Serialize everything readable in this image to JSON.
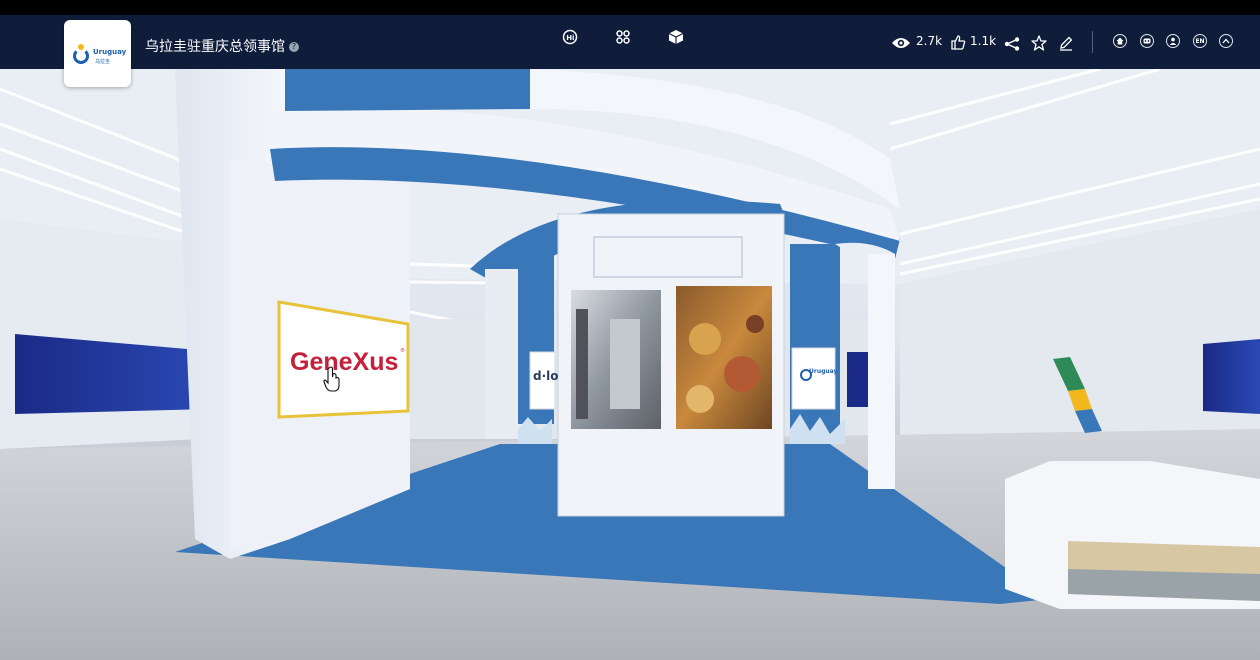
{
  "header": {
    "title": "乌拉圭驻重庆总领事馆",
    "logo": {
      "name": "Uruguay",
      "sub": "乌拉圭"
    },
    "center_icons": [
      "hi-chat-icon",
      "command-icon",
      "cube-icon"
    ],
    "stats": {
      "views": "2.7k",
      "likes": "1.1k"
    },
    "right_icons": [
      "share-icon",
      "star-icon",
      "edit-icon",
      "home-icon",
      "vr-icon",
      "user-icon",
      "language-icon",
      "collapse-icon"
    ],
    "language_label": "EN"
  },
  "scene": {
    "sign_label": "GeneXus",
    "sign_mark": "®",
    "side_sign_label": "d·lo",
    "uruguay_panel_label": "Uruguay"
  },
  "colors": {
    "header_bg": "#0f1d3b",
    "accent_blue": "#3a77b8",
    "brand_red": "#c4203a"
  }
}
